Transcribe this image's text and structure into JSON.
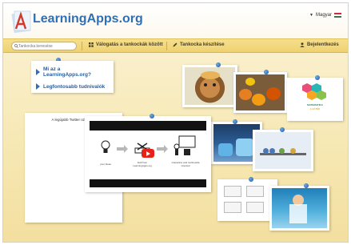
{
  "header": {
    "logo_text": "LearningApps.org",
    "language": "Magyar"
  },
  "navbar": {
    "search_placeholder": "Tankocka keresése",
    "browse_label": "Válogatás a tankockák között",
    "create_label": "Tankocka készítése",
    "login_label": "Bejelentkezés"
  },
  "menu": {
    "items": [
      {
        "label": "Mi az a LearningApps.org?"
      },
      {
        "label": "Legfontosabb tudnivalók"
      }
    ]
  },
  "twitter": {
    "title": "A legújabb Twitter üzenetek"
  },
  "video": {
    "captions": [
      "your ideas",
      "built from LearningApps.org",
      "interactive and multimedia oriented"
    ]
  },
  "thumbs": {
    "math_title": "MATEMATIKA",
    "math_sub": "A JÁTÉK"
  },
  "colors": {
    "brand_blue": "#2f6fb3",
    "nav_yellow": "#efd170",
    "background": "#f7e9b6",
    "pin_blue": "#1d5aa3"
  }
}
